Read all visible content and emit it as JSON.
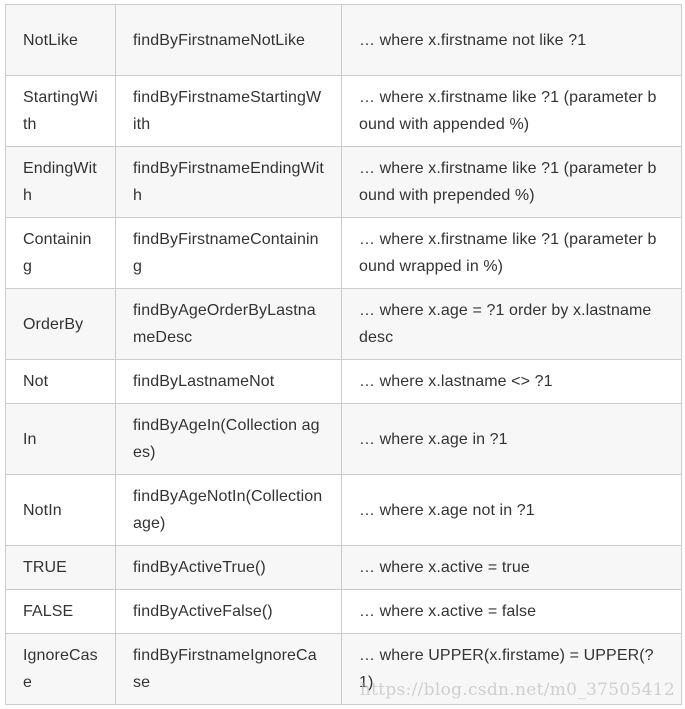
{
  "table": {
    "rows": [
      {
        "keyword": "NotLike",
        "sample": "findByFirstnameNotLike",
        "jpql": "… where x.firstname not like ?1"
      },
      {
        "keyword": "StartingWith",
        "sample": "findByFirstnameStartingWith",
        "jpql": "… where x.firstname like ?1 (parameter bound with appended %)"
      },
      {
        "keyword": "EndingWith",
        "sample": "findByFirstnameEndingWith",
        "jpql": "… where x.firstname like ?1 (parameter bound with prepended %)"
      },
      {
        "keyword": "Containing",
        "sample": "findByFirstnameContaining",
        "jpql": "… where x.firstname like ?1 (parameter bound wrapped in %)"
      },
      {
        "keyword": "OrderBy",
        "sample": "findByAgeOrderByLastnameDesc",
        "jpql": "… where x.age = ?1 order by x.lastname desc"
      },
      {
        "keyword": "Not",
        "sample": "findByLastnameNot",
        "jpql": "… where x.lastname <> ?1"
      },
      {
        "keyword": "In",
        "sample": "findByAgeIn(Collection ages)",
        "jpql": "… where x.age in ?1"
      },
      {
        "keyword": "NotIn",
        "sample": "findByAgeNotIn(Collectionage)",
        "jpql": "… where x.age not in ?1"
      },
      {
        "keyword": "TRUE",
        "sample": "findByActiveTrue()",
        "jpql": "… where x.active = true"
      },
      {
        "keyword": "FALSE",
        "sample": "findByActiveFalse()",
        "jpql": "… where x.active = false"
      },
      {
        "keyword": "IgnoreCase",
        "sample": "findByFirstnameIgnoreCase",
        "jpql": "… where UPPER(x.firstame) = UPPER(?1)"
      }
    ]
  },
  "watermark": "https://blog.csdn.net/m0_37505412",
  "colors": {
    "row_alt": "#f7f7f7",
    "row_plain": "#ffffff",
    "border": "#cccccc",
    "text": "#333333"
  }
}
